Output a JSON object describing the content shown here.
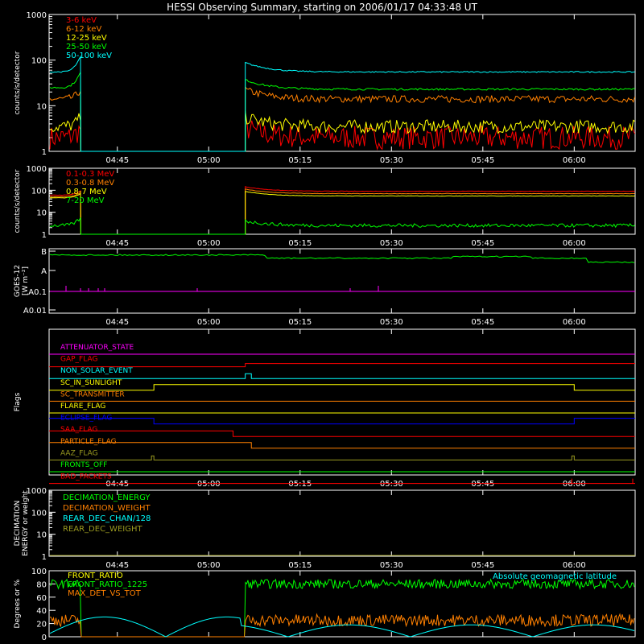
{
  "title": "HESSI Observing Summary, starting on 2006/01/17 04:33:48 UT",
  "time_axis": {
    "start": "04:33:48",
    "end": "06:10",
    "ticks": [
      "04:45",
      "05:00",
      "05:15",
      "05:30",
      "05:45",
      "06:00"
    ]
  },
  "colors": {
    "background": "#000000",
    "axis": "#ffffff",
    "red": "#ff0000",
    "orange": "#ff8000",
    "yellow": "#ffff00",
    "green": "#00ff00",
    "cyan": "#00ffff",
    "magenta": "#ff00ff",
    "blue": "#0000ff",
    "olive": "#9a9a20",
    "white": "#ffffff"
  },
  "chart_data": [
    {
      "id": "lowE",
      "type": "line",
      "ylabel": "counts/s/detector",
      "yscale": "log",
      "ylim": [
        1,
        1000
      ],
      "yticks": [
        "1",
        "10",
        "100",
        "1000"
      ],
      "legend_placement": "top-left",
      "gap": [
        "04:39",
        "05:06"
      ],
      "series": [
        {
          "name": "3-6 keV",
          "color": "red",
          "level": 2,
          "noise": 1.8,
          "pre": 2
        },
        {
          "name": "6-12 keV",
          "color": "orange",
          "level": 14,
          "noise": 1.2,
          "pre": 14
        },
        {
          "name": "12-25 keV",
          "color": "yellow",
          "level": 3.5,
          "noise": 1.4,
          "pre": 3.5
        },
        {
          "name": "25-50 keV",
          "color": "green",
          "level": 23,
          "noise": 1.05,
          "pre": 25
        },
        {
          "name": "50-100 keV",
          "color": "cyan",
          "level": 55,
          "noise": 1.03,
          "pre": 55
        }
      ]
    },
    {
      "id": "highE",
      "type": "line",
      "ylabel": "counts/s/detector",
      "yscale": "log",
      "ylim": [
        1,
        1000
      ],
      "yticks": [
        "1",
        "10",
        "100",
        "1000"
      ],
      "legend_placement": "top-left",
      "gap": [
        "04:39",
        "05:06"
      ],
      "series": [
        {
          "name": "0.1-0.3 MeV",
          "color": "red",
          "level": 90,
          "noise": 1.02,
          "pre": 60
        },
        {
          "name": "0.3-0.8 MeV",
          "color": "orange",
          "level": 70,
          "noise": 1.02,
          "pre": 50
        },
        {
          "name": "0.8-7 MeV",
          "color": "yellow",
          "level": 55,
          "noise": 1.02,
          "pre": 45
        },
        {
          "name": "7-20 MeV",
          "color": "green",
          "level": 2.5,
          "noise": 1.2,
          "pre": 2.5
        }
      ]
    },
    {
      "id": "goes",
      "type": "line",
      "ylabel": "GOES-12",
      "ylabel2": "[W m⁻²]",
      "yscale": "log",
      "yticks": [
        "A0.01",
        "A0.1",
        "A",
        "B"
      ],
      "series": [
        {
          "name": "GOES high",
          "color": "green",
          "level": "B"
        },
        {
          "name": "GOES low",
          "color": "magenta",
          "level": "A0.1"
        }
      ]
    },
    {
      "id": "flags",
      "type": "line",
      "ylabel": "Flags",
      "flags": [
        {
          "name": "ATTENUATOR_STATE",
          "color": "magenta"
        },
        {
          "name": "GAP_FLAG",
          "color": "red"
        },
        {
          "name": "NON_SOLAR_EVENT",
          "color": "cyan"
        },
        {
          "name": "SC_IN_SUNLIGHT",
          "color": "yellow"
        },
        {
          "name": "SC_TRANSMITTER",
          "color": "orange"
        },
        {
          "name": "FLARE_FLAG",
          "color": "yellow"
        },
        {
          "name": "ECLIPSE_FLAG",
          "color": "blue"
        },
        {
          "name": "SAA_FLAG",
          "color": "red"
        },
        {
          "name": "PARTICLE_FLAG",
          "color": "orange"
        },
        {
          "name": "AAZ_FLAG",
          "color": "olive"
        },
        {
          "name": "FRONTS_OFF",
          "color": "green"
        },
        {
          "name": "BAD_PACKETS",
          "color": "red"
        }
      ]
    },
    {
      "id": "decim",
      "type": "line",
      "ylabel": "DECIMATION",
      "ylabel2": "ENERGY or weight",
      "yscale": "log",
      "ylim": [
        1,
        1000
      ],
      "yticks": [
        "1",
        "10",
        "100",
        "1000"
      ],
      "legend_placement": "top-left",
      "series": [
        {
          "name": "DECIMATION_ENERGY",
          "color": "green"
        },
        {
          "name": "DECIMATION_WEIGHT",
          "color": "orange"
        },
        {
          "name": "REAR_DEC_CHAN/128",
          "color": "cyan"
        },
        {
          "name": "REAR_DEC_WEIGHT",
          "color": "olive"
        }
      ]
    },
    {
      "id": "ratio",
      "type": "line",
      "ylabel": "Degrees or %",
      "ylim": [
        0,
        100
      ],
      "yticks": [
        "0",
        "20",
        "40",
        "60",
        "80",
        "100"
      ],
      "legend_placement": "top-left",
      "series": [
        {
          "name": "FRONT_RATIO",
          "color": "yellow"
        },
        {
          "name": "FRONT_RATIO_1225",
          "color": "green",
          "level": 80
        },
        {
          "name": "MAX_DET_VS_TOT",
          "color": "orange",
          "level": 25
        },
        {
          "name": "Absolute geomagnetic latitude",
          "color": "cyan",
          "max": 30
        }
      ]
    }
  ]
}
